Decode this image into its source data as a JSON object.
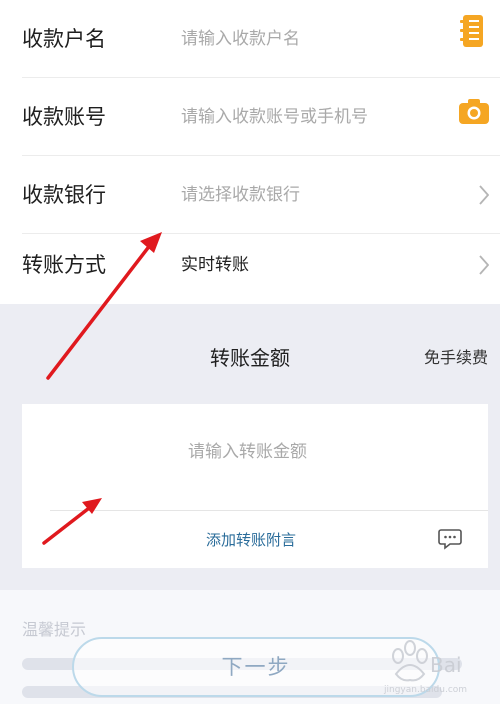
{
  "form": {
    "rows": [
      {
        "label": "收款户名",
        "value": "请输入收款户名",
        "icon": "contact-book-icon"
      },
      {
        "label": "收款账号",
        "value": "请输入收款账号或手机号",
        "icon": "camera-icon"
      },
      {
        "label": "收款银行",
        "value": "请选择收款银行",
        "icon": "chevron-right-icon"
      },
      {
        "label": "转账方式",
        "value": "实时转账",
        "icon": "chevron-right-icon"
      }
    ]
  },
  "amount": {
    "title": "转账金额",
    "fee_note": "免手续费",
    "placeholder": "请输入转账金额",
    "remark_label": "添加转账附言",
    "remark_icon": "message-icon"
  },
  "tips": {
    "title": "温馨提示"
  },
  "next_button": {
    "label": "下一步"
  },
  "watermark": {
    "text": "Bai经验",
    "sub": "jingyan.baidu.com"
  },
  "colors": {
    "accent": "#F5A623",
    "link": "#2A6C9A",
    "arrow": "#E0191E",
    "section_bg": "#ECEDF3"
  }
}
